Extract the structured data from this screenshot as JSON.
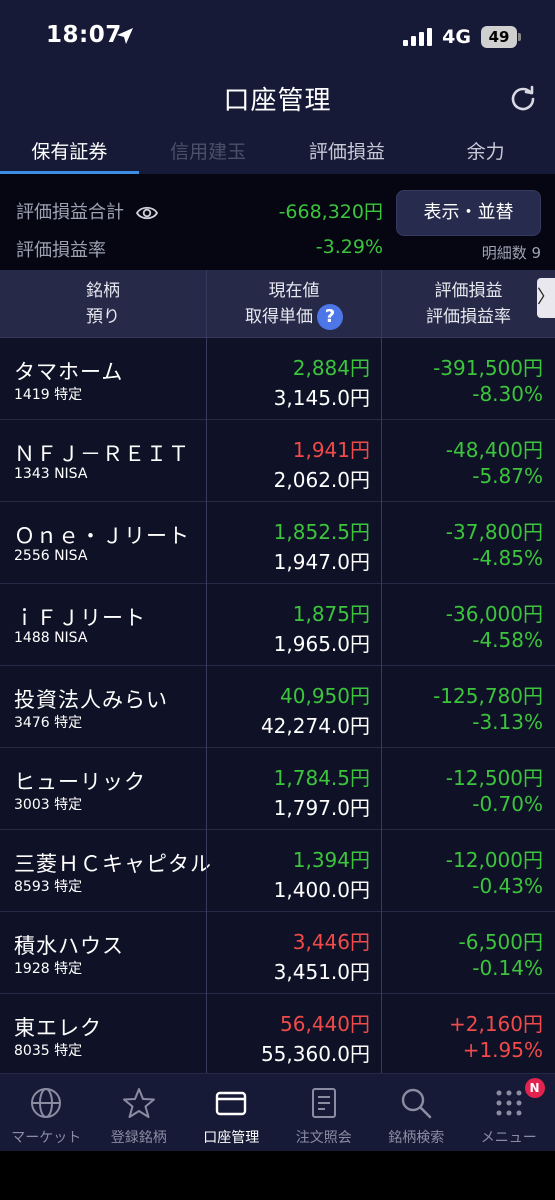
{
  "status_bar": {
    "time": "18:07",
    "network": "4G",
    "battery": "49"
  },
  "header": {
    "title": "口座管理"
  },
  "tabs": [
    {
      "label": "保有証券"
    },
    {
      "label": "信用建玉"
    },
    {
      "label": "評価損益"
    },
    {
      "label": "余力"
    }
  ],
  "summary": {
    "total_label": "評価損益合計",
    "total_value": "-668,320円",
    "rate_label": "評価損益率",
    "rate_value": "-3.29%",
    "sort_button": "表示・並替",
    "detail_count": "明細数 9"
  },
  "table_header": {
    "col1_top": "銘柄",
    "col1_bottom": "預り",
    "col2_top": "現在値",
    "col2_bottom": "取得単価",
    "col3_top": "評価損益",
    "col3_bottom": "評価損益率",
    "help": "?",
    "scroll": "〉"
  },
  "holdings": [
    {
      "name": "タマホーム",
      "code": "1419 特定",
      "price": "2,884円",
      "cost": "3,145.0円",
      "pl": "-391,500円",
      "pl_rate": "-8.30%"
    },
    {
      "name": "ＮＦＪ－ＲＥＩＴ",
      "code": "1343 NISA",
      "price": "1,941円",
      "cost": "2,062.0円",
      "pl": "-48,400円",
      "pl_rate": "-5.87%"
    },
    {
      "name": "Ｏｎｅ・Ｊリート",
      "code": "2556 NISA",
      "price": "1,852.5円",
      "cost": "1,947.0円",
      "pl": "-37,800円",
      "pl_rate": "-4.85%"
    },
    {
      "name": "ｉＦＪリート",
      "code": "1488 NISA",
      "price": "1,875円",
      "cost": "1,965.0円",
      "pl": "-36,000円",
      "pl_rate": "-4.58%"
    },
    {
      "name": "投資法人みらい",
      "code": "3476 特定",
      "price": "40,950円",
      "cost": "42,274.0円",
      "pl": "-125,780円",
      "pl_rate": "-3.13%"
    },
    {
      "name": "ヒューリック",
      "code": "3003 特定",
      "price": "1,784.5円",
      "cost": "1,797.0円",
      "pl": "-12,500円",
      "pl_rate": "-0.70%"
    },
    {
      "name": "三菱ＨＣキャピタル",
      "code": "8593 特定",
      "price": "1,394円",
      "cost": "1,400.0円",
      "pl": "-12,000円",
      "pl_rate": "-0.43%"
    },
    {
      "name": "積水ハウス",
      "code": "1928 特定",
      "price": "3,446円",
      "cost": "3,451.0円",
      "pl": "-6,500円",
      "pl_rate": "-0.14%"
    },
    {
      "name": "東エレク",
      "code": "8035 特定",
      "price": "56,440円",
      "cost": "55,360.0円",
      "pl": "+2,160円",
      "pl_rate": "+1.95%"
    }
  ],
  "bottom_nav": [
    {
      "label": "マーケット"
    },
    {
      "label": "登録銘柄"
    },
    {
      "label": "口座管理"
    },
    {
      "label": "注文照会"
    },
    {
      "label": "銘柄検索"
    },
    {
      "label": "メニュー",
      "badge": "N"
    }
  ],
  "colors": {
    "gain_green": "#3cc43c",
    "loss_red": "#f04a4a",
    "accent_blue": "#3a8fe5",
    "header_bg": "#161a36"
  }
}
